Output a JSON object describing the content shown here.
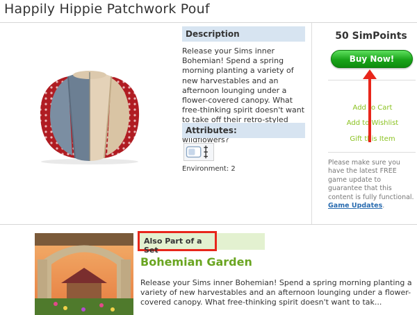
{
  "page_title": "Happily Hippie Patchwork Pouf",
  "description": {
    "heading": "Description",
    "text": "Release your Sims inner Bohemian! Spend a spring morning planting a variety of new harvestables and an afternoon lounging under a flower-covered canopy. What free-thinking spirit doesn't want to take off their retro-styled boots and walk among the wildflowers?"
  },
  "attributes": {
    "heading": "Attributes:",
    "environment": "Environment: 2"
  },
  "purchase": {
    "price": "50 SimPoints",
    "buy_label": "Buy Now!",
    "add_to_cart": "Add to Cart",
    "add_to_wishlist": "Add to Wishlist",
    "gift": "Gift this Item",
    "note_prefix": "Please make sure you have the latest FREE game update to guarantee that this content is fully functional.",
    "note_link": "Game Updates",
    "note_suffix": "."
  },
  "set": {
    "heading": "Also Part of a Set",
    "title": "Bohemian Garden",
    "text": "Release your Sims inner Bohemian! Spend a spring morning planting a variety of new harvestables and an afternoon lounging under a flower-covered canopy. What free-thinking spirit doesn't want to tak..."
  },
  "colors": {
    "accent_green": "#8ac21f",
    "buy_button": "#19a319",
    "section_header": "#d7e4f1",
    "highlight_red": "#e8261b"
  },
  "icons": {
    "attribute": "environment-attribute-icon",
    "annotation": "red-arrow-annotation"
  }
}
